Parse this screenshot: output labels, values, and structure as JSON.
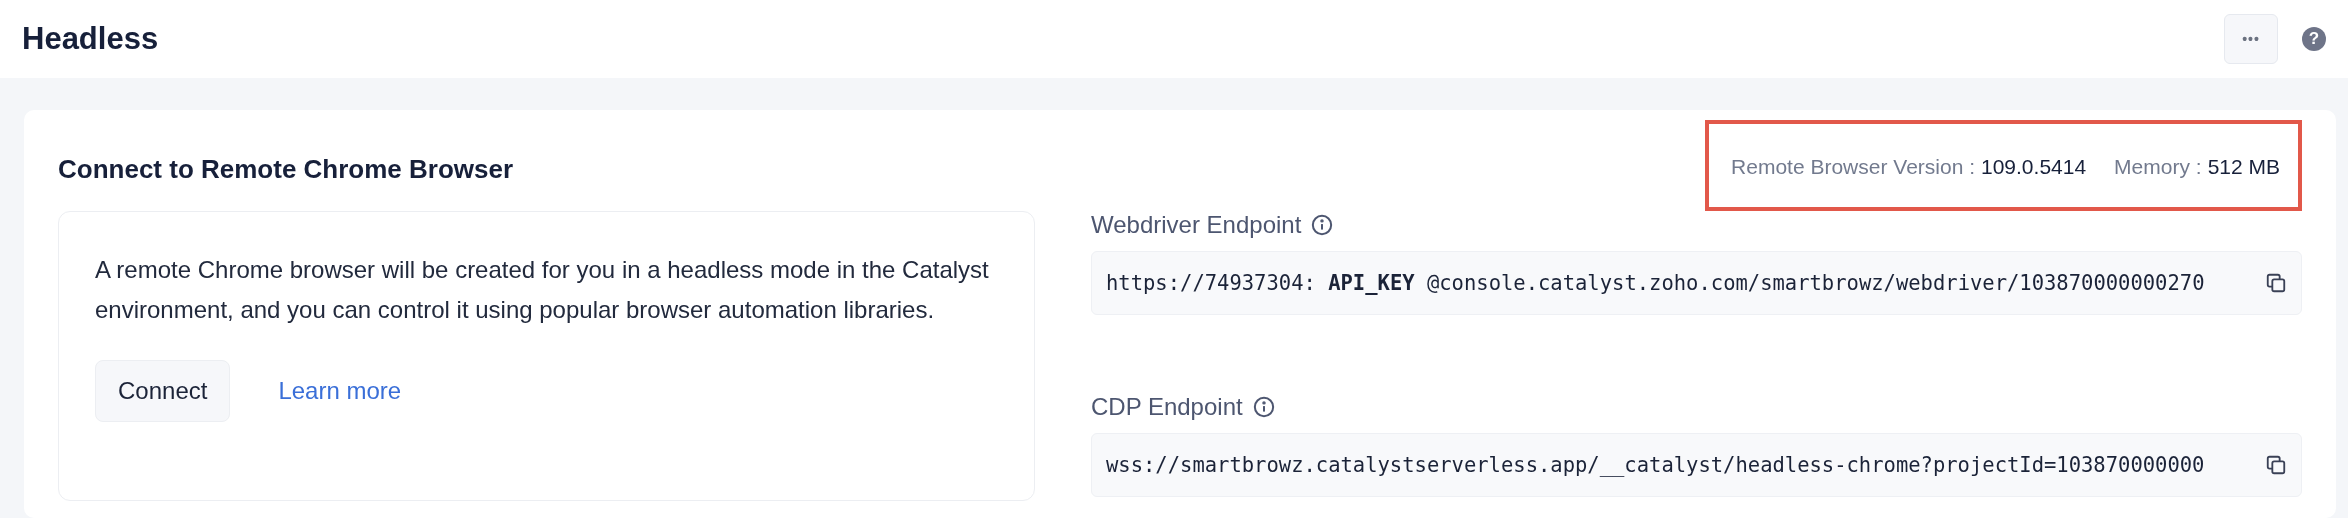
{
  "header": {
    "title": "Headless",
    "menu_button": "•••",
    "help_icon": "?"
  },
  "card": {
    "title": "Connect to Remote Chrome Browser",
    "info": {
      "text": "A remote Chrome browser will be created for you in a headless mode in the Catalyst environment, and you can control it using popular browser automation libraries.",
      "button": "Connect",
      "link": "Learn more"
    },
    "meta": {
      "highlighted": true,
      "items": [
        {
          "label": "Remote Browser Version :",
          "value": "109.0.5414"
        },
        {
          "label": "Memory :",
          "value": "512 MB"
        }
      ]
    },
    "endpoints": [
      {
        "label": "Webdriver Endpoint",
        "value": "https://74937304: **API_KEY** @console.catalyst.zoho.com/smartbrowz/webdriver/103870000000270"
      },
      {
        "label": "CDP Endpoint",
        "value": "wss://smartbrowz.catalystserverless.app/__catalyst/headless-chrome?projectId=103870000000"
      }
    ]
  }
}
